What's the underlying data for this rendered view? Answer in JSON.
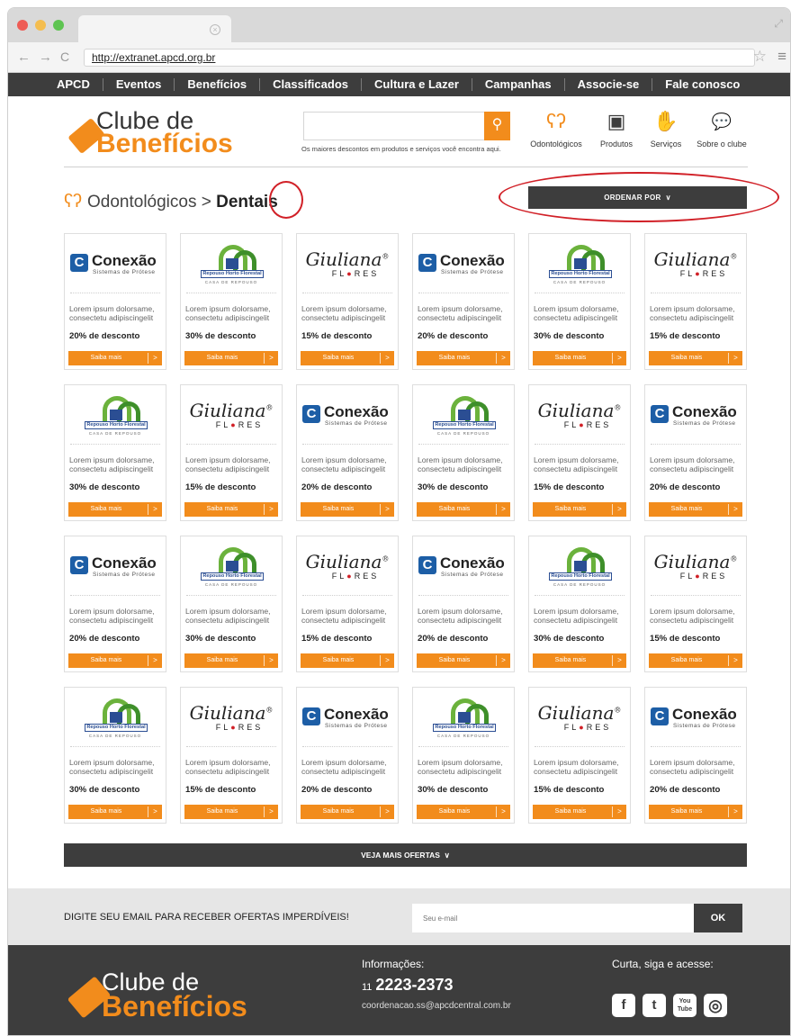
{
  "browser": {
    "url": "http://extranet.apcd.org.br",
    "tab_close": "×",
    "nav_back": "←",
    "nav_forward": "→",
    "nav_reload": "C",
    "star": "☆",
    "menu": "≡",
    "expand": "⤢"
  },
  "topnav": [
    "APCD",
    "Eventos",
    "Benefícios",
    "Classificados",
    "Cultura e Lazer",
    "Campanhas",
    "Associe-se",
    "Fale conosco"
  ],
  "logo": {
    "line1": "Clube de",
    "line2": "Benefícios"
  },
  "search": {
    "hint": "Os maiores descontos em produtos e serviços você encontra aqui.",
    "icon": "⚲"
  },
  "categories": [
    {
      "label": "Odontológicos",
      "icon": "ʕʔ"
    },
    {
      "label": "Produtos",
      "icon": "▣"
    },
    {
      "label": "Serviços",
      "icon": "✋"
    },
    {
      "label": "Sobre o clube",
      "icon": "💬"
    }
  ],
  "breadcrumb": {
    "parent": "Odontológicos",
    "separator": ">",
    "current": "Dentais",
    "icon": "ʕʔ"
  },
  "order_button": "ORDENAR POR",
  "chevron": "∨",
  "arrow": ">",
  "brands": {
    "conexao": {
      "name": "Conexão",
      "sub": "Sistemas de Prótese",
      "mark": "C"
    },
    "repouso": {
      "name": "Repouso Horto Florestal",
      "sub": "CASA DE REPOUSO"
    },
    "giuliana": {
      "name": "Giuliana",
      "reg": "®",
      "sub1": "FL",
      "sub2": "●",
      "sub3": "RES"
    }
  },
  "offers": [
    {
      "brand": "conexao",
      "description": "Lorem ipsum dolorsame, consectetu adipiscingelit",
      "discount": "20% de desconto",
      "cta": "Saiba mais"
    },
    {
      "brand": "repouso",
      "description": "Lorem ipsum dolorsame, consectetu adipiscingelit",
      "discount": "30% de desconto",
      "cta": "Saiba mais"
    },
    {
      "brand": "giuliana",
      "description": "Lorem ipsum dolorsame, consectetu adipiscingelit",
      "discount": "15% de desconto",
      "cta": "Saiba mais"
    },
    {
      "brand": "conexao",
      "description": "Lorem ipsum dolorsame, consectetu adipiscingelit",
      "discount": "20% de desconto",
      "cta": "Saiba mais"
    },
    {
      "brand": "repouso",
      "description": "Lorem ipsum dolorsame, consectetu adipiscingelit",
      "discount": "30% de desconto",
      "cta": "Saiba mais"
    },
    {
      "brand": "giuliana",
      "description": "Lorem ipsum dolorsame, consectetu adipiscingelit",
      "discount": "15% de desconto",
      "cta": "Saiba mais"
    },
    {
      "brand": "repouso",
      "description": "Lorem ipsum dolorsame, consectetu adipiscingelit",
      "discount": "30% de desconto",
      "cta": "Saiba mais"
    },
    {
      "brand": "giuliana",
      "description": "Lorem ipsum dolorsame, consectetu adipiscingelit",
      "discount": "15% de desconto",
      "cta": "Saiba mais"
    },
    {
      "brand": "conexao",
      "description": "Lorem ipsum dolorsame, consectetu adipiscingelit",
      "discount": "20% de desconto",
      "cta": "Saiba mais"
    },
    {
      "brand": "repouso",
      "description": "Lorem ipsum dolorsame, consectetu adipiscingelit",
      "discount": "30% de desconto",
      "cta": "Saiba mais"
    },
    {
      "brand": "giuliana",
      "description": "Lorem ipsum dolorsame, consectetu adipiscingelit",
      "discount": "15% de desconto",
      "cta": "Saiba mais"
    },
    {
      "brand": "conexao",
      "description": "Lorem ipsum dolorsame, consectetu adipiscingelit",
      "discount": "20% de desconto",
      "cta": "Saiba mais"
    },
    {
      "brand": "conexao",
      "description": "Lorem ipsum dolorsame, consectetu adipiscingelit",
      "discount": "20% de desconto",
      "cta": "Saiba mais"
    },
    {
      "brand": "repouso",
      "description": "Lorem ipsum dolorsame, consectetu adipiscingelit",
      "discount": "30% de desconto",
      "cta": "Saiba mais"
    },
    {
      "brand": "giuliana",
      "description": "Lorem ipsum dolorsame, consectetu adipiscingelit",
      "discount": "15% de desconto",
      "cta": "Saiba mais"
    },
    {
      "brand": "conexao",
      "description": "Lorem ipsum dolorsame, consectetu adipiscingelit",
      "discount": "20% de desconto",
      "cta": "Saiba mais"
    },
    {
      "brand": "repouso",
      "description": "Lorem ipsum dolorsame, consectetu adipiscingelit",
      "discount": "30% de desconto",
      "cta": "Saiba mais"
    },
    {
      "brand": "giuliana",
      "description": "Lorem ipsum dolorsame, consectetu adipiscingelit",
      "discount": "15% de desconto",
      "cta": "Saiba mais"
    },
    {
      "brand": "repouso",
      "description": "Lorem ipsum dolorsame, consectetu adipiscingelit",
      "discount": "30% de desconto",
      "cta": "Saiba mais"
    },
    {
      "brand": "giuliana",
      "description": "Lorem ipsum dolorsame, consectetu adipiscingelit",
      "discount": "15% de desconto",
      "cta": "Saiba mais"
    },
    {
      "brand": "conexao",
      "description": "Lorem ipsum dolorsame, consectetu adipiscingelit",
      "discount": "20% de desconto",
      "cta": "Saiba mais"
    },
    {
      "brand": "repouso",
      "description": "Lorem ipsum dolorsame, consectetu adipiscingelit",
      "discount": "30% de desconto",
      "cta": "Saiba mais"
    },
    {
      "brand": "giuliana",
      "description": "Lorem ipsum dolorsame, consectetu adipiscingelit",
      "discount": "15% de desconto",
      "cta": "Saiba mais"
    },
    {
      "brand": "conexao",
      "description": "Lorem ipsum dolorsame, consectetu adipiscingelit",
      "discount": "20% de desconto",
      "cta": "Saiba mais"
    }
  ],
  "more_button": "VEJA MAIS OFERTAS",
  "newsletter": {
    "label": "DIGITE SEU EMAIL PARA RECEBER OFERTAS IMPERDÍVEIS!",
    "placeholder": "Seu e-mail",
    "button": "OK"
  },
  "footer": {
    "info_title": "Informações:",
    "phone_ddd": "11",
    "phone": "2223-2373",
    "email": "coordenacao.ss@apcdcentral.com.br",
    "social_title": "Curta, siga e acesse:",
    "social": [
      {
        "name": "facebook",
        "glyph": "f"
      },
      {
        "name": "twitter",
        "glyph": "t"
      },
      {
        "name": "youtube",
        "glyph": "You Tube"
      },
      {
        "name": "instagram",
        "glyph": "◎"
      }
    ]
  },
  "colors": {
    "accent": "#f28c1c",
    "dark": "#3d3d3d",
    "annotation": "#d12027"
  }
}
